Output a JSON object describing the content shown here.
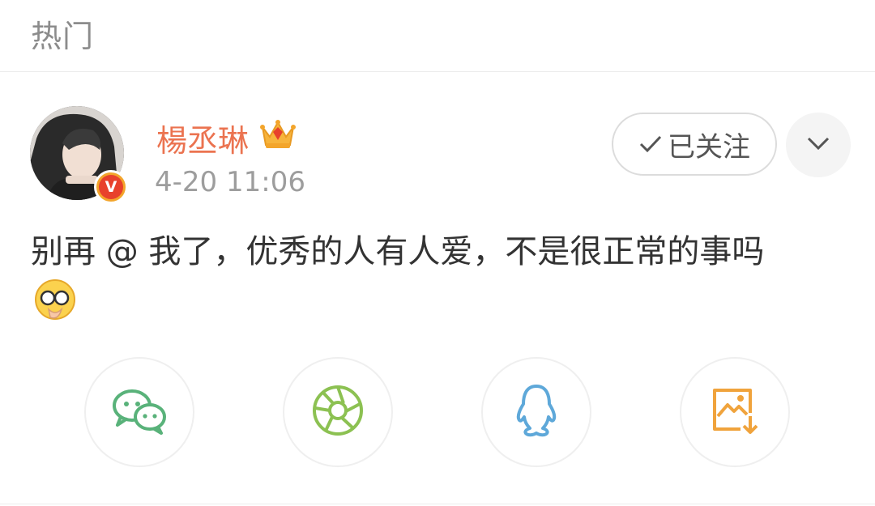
{
  "header": {
    "title": "热门"
  },
  "post": {
    "username": "楊丞琳",
    "timestamp": "4-20 11:06",
    "text": "别再 @ 我了，优秀的人有人爱，不是很正常的事吗",
    "verified_badge": "V"
  },
  "actions": {
    "follow_label": "已关注",
    "menu_icon": "chevron-down-icon"
  },
  "share": {
    "items": [
      {
        "icon": "wechat-icon",
        "color": "#59b27a"
      },
      {
        "icon": "moments-icon",
        "color": "#8cc152"
      },
      {
        "icon": "qq-icon",
        "color": "#5ea8d9"
      },
      {
        "icon": "save-image-icon",
        "color": "#f0a33c"
      }
    ]
  },
  "colors": {
    "username": "#eb7350",
    "timestamp": "#9d9d9d",
    "body_text": "#333333",
    "header_text": "#8c8c8c"
  }
}
